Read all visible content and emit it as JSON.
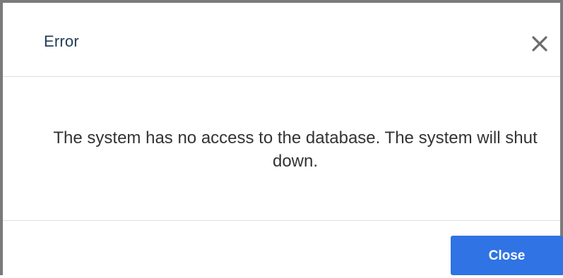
{
  "dialog": {
    "title": "Error",
    "message": "The system has no access to the database. The system will shut down.",
    "close_button_label": "Close",
    "close_icon": "close-icon"
  },
  "colors": {
    "title": "#1f3b57",
    "message": "#333333",
    "button_bg": "#2f73e4",
    "button_text": "#ffffff",
    "frame": "#7a7a7a",
    "divider": "#dedede"
  }
}
